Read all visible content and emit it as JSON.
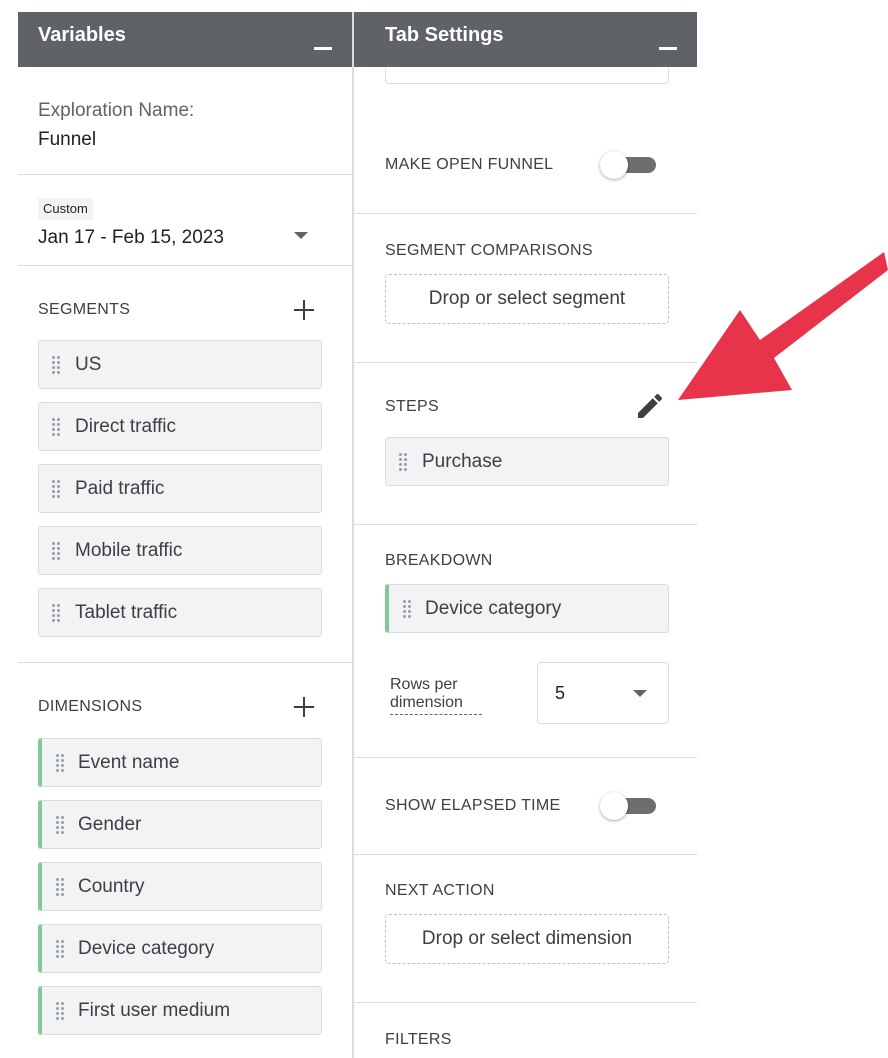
{
  "variables": {
    "title": "Variables",
    "exploration_name_label": "Exploration Name:",
    "exploration_name": "Funnel",
    "date_badge": "Custom",
    "date_range": "Jan 17 - Feb 15, 2023",
    "segments_title": "SEGMENTS",
    "segments": [
      "US",
      "Direct traffic",
      "Paid traffic",
      "Mobile traffic",
      "Tablet traffic"
    ],
    "dimensions_title": "DIMENSIONS",
    "dimensions": [
      "Event name",
      "Gender",
      "Country",
      "Device category",
      "First user medium"
    ]
  },
  "tab_settings": {
    "title": "Tab Settings",
    "make_open_funnel": {
      "label": "MAKE OPEN FUNNEL",
      "on": false
    },
    "segment_comparisons": {
      "title": "SEGMENT COMPARISONS",
      "placeholder": "Drop or select segment"
    },
    "steps": {
      "title": "STEPS",
      "items": [
        "Purchase"
      ]
    },
    "breakdown": {
      "title": "BREAKDOWN",
      "items": [
        "Device category"
      ]
    },
    "rows_per_dimension": {
      "label": "Rows per dimension",
      "value": "5"
    },
    "show_elapsed_time": {
      "label": "SHOW ELAPSED TIME",
      "on": false
    },
    "next_action": {
      "title": "NEXT ACTION",
      "placeholder": "Drop or select dimension"
    },
    "filters": {
      "title": "FILTERS"
    }
  },
  "colors": {
    "header_bg": "#5f6368",
    "dimension_accent": "#81c995",
    "annotation_arrow": "#e8344a"
  }
}
